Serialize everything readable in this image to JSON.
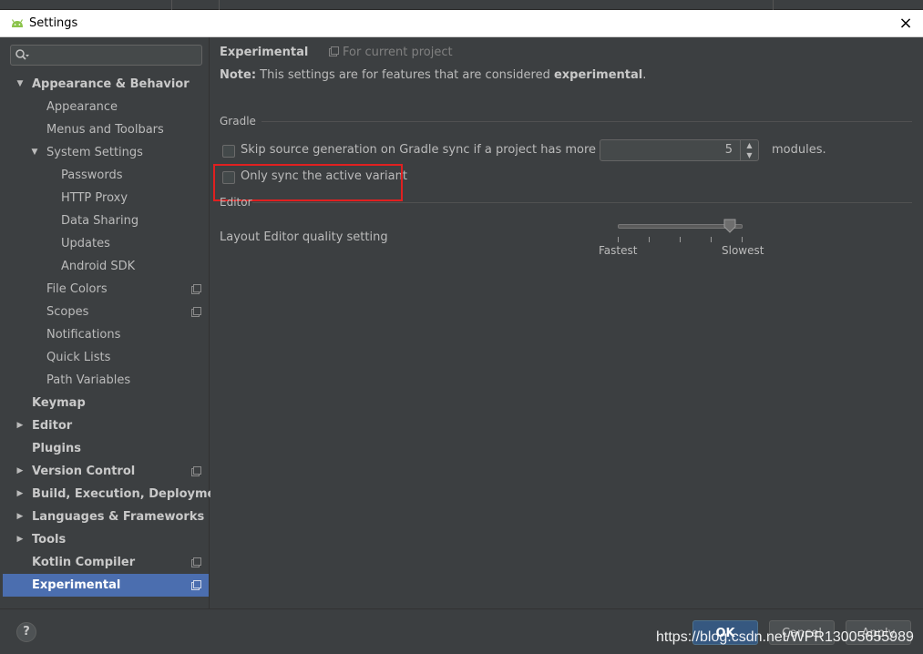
{
  "window": {
    "title": "Settings",
    "close": "×"
  },
  "search": {
    "placeholder": ""
  },
  "sidebar": {
    "items": [
      {
        "label": "Appearance & Behavior",
        "bold": true,
        "arrow": "▼",
        "level": 0
      },
      {
        "label": "Appearance",
        "level": 1
      },
      {
        "label": "Menus and Toolbars",
        "level": 1
      },
      {
        "label": "System Settings",
        "arrow": "▼",
        "level": 1
      },
      {
        "label": "Passwords",
        "level": 2
      },
      {
        "label": "HTTP Proxy",
        "level": 2
      },
      {
        "label": "Data Sharing",
        "level": 2
      },
      {
        "label": "Updates",
        "level": 2
      },
      {
        "label": "Android SDK",
        "level": 2
      },
      {
        "label": "File Colors",
        "level": 1,
        "project": true
      },
      {
        "label": "Scopes",
        "level": 1,
        "project": true
      },
      {
        "label": "Notifications",
        "level": 1
      },
      {
        "label": "Quick Lists",
        "level": 1
      },
      {
        "label": "Path Variables",
        "level": 1
      },
      {
        "label": "Keymap",
        "bold": true,
        "level": 0
      },
      {
        "label": "Editor",
        "bold": true,
        "arrow": "▶",
        "level": 0
      },
      {
        "label": "Plugins",
        "bold": true,
        "level": 0
      },
      {
        "label": "Version Control",
        "bold": true,
        "arrow": "▶",
        "level": 0,
        "project": true
      },
      {
        "label": "Build, Execution, Deployment",
        "bold": true,
        "arrow": "▶",
        "level": 0
      },
      {
        "label": "Languages & Frameworks",
        "bold": true,
        "arrow": "▶",
        "level": 0
      },
      {
        "label": "Tools",
        "bold": true,
        "arrow": "▶",
        "level": 0
      },
      {
        "label": "Kotlin Compiler",
        "bold": true,
        "level": 0,
        "project": true
      },
      {
        "label": "Experimental",
        "bold": true,
        "level": 0,
        "project": true,
        "selected": true
      }
    ]
  },
  "main": {
    "title": "Experimental",
    "scope": "For current project",
    "note_prefix": "Note:",
    "note_text": " This settings are for features that are considered ",
    "note_bold": "experimental",
    "note_suffix": ".",
    "gradle_section": "Gradle",
    "skip_source_label": "Skip source generation on Gradle sync if a project has more than",
    "skip_source_checked": false,
    "modules_value": "5",
    "modules_label": "modules.",
    "only_sync_label": "Only sync the active variant",
    "only_sync_checked": false,
    "editor_section": "Editor",
    "quality_label": "Layout Editor quality setting",
    "slider_min_label": "Fastest",
    "slider_max_label": "Slowest",
    "slider_level_fraction": 0.9
  },
  "footer": {
    "help": "?",
    "ok": "OK",
    "cancel": "Cancel",
    "apply": "Apply",
    "watermark": "https://blog.csdn.net/WPR13005655989"
  },
  "colors": {
    "selection": "#4b6eaf",
    "highlight_box": "#e02020",
    "panel_bg": "#3c3f41",
    "primary_button": "#365880"
  }
}
